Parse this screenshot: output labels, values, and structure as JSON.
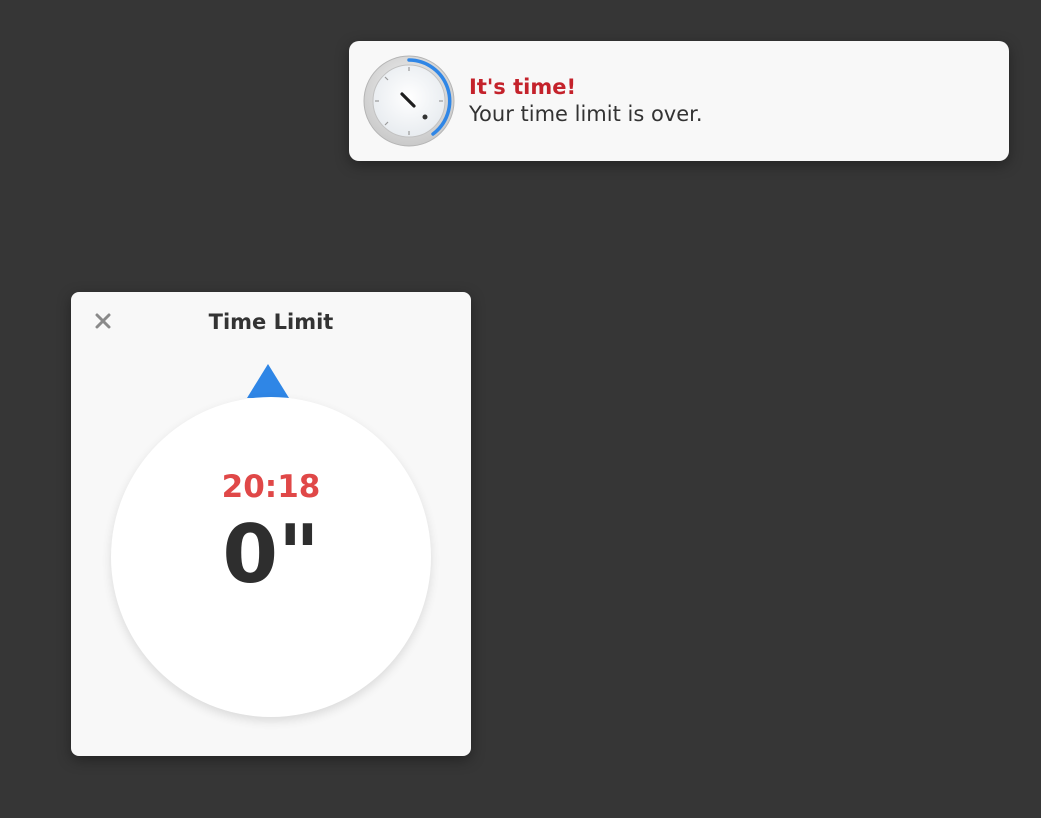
{
  "notification": {
    "title": "It's time!",
    "body": "Your time limit is over.",
    "icon": "timer-dial-icon",
    "title_color": "#c4222b",
    "icon_accent_color": "#2f86e6"
  },
  "timer_window": {
    "title": "Time Limit",
    "close_icon": "close-icon",
    "clock_time": "20:18",
    "remaining": "0\"",
    "pointer_color": "#2f86e6",
    "clock_time_color": "#e04848"
  }
}
